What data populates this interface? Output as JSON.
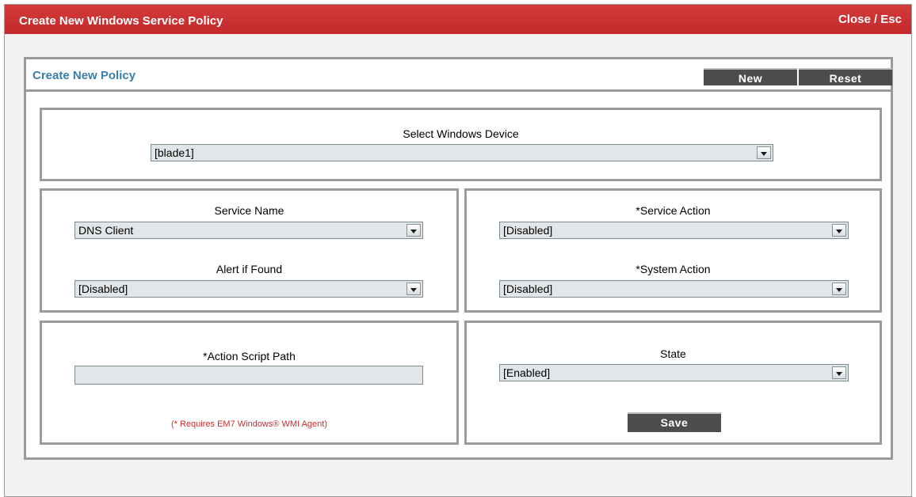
{
  "window": {
    "title": "Create New Windows Service Policy",
    "close_label": "Close / Esc"
  },
  "panel": {
    "title": "Create New Policy",
    "new_label": "New",
    "reset_label": "Reset"
  },
  "device": {
    "label": "Select Windows Device",
    "value": "[blade1]"
  },
  "service": {
    "name_label": "Service Name",
    "name_value": "DNS Client",
    "alert_label": "Alert if Found",
    "alert_value": "[Disabled]"
  },
  "actions": {
    "service_action_label": "*Service Action",
    "service_action_value": "[Disabled]",
    "system_action_label": "*System Action",
    "system_action_value": "[Disabled]"
  },
  "script": {
    "label": "*Action Script Path",
    "value": "",
    "note": "(* Requires EM7 Windows® WMI Agent)"
  },
  "state": {
    "label": "State",
    "value": "[Enabled]",
    "save_label": "Save"
  },
  "colors": {
    "titlebar": "#c42a2b",
    "panel_title": "#3a7fa8",
    "button": "#4d4d4d",
    "note": "#d02a2a"
  }
}
